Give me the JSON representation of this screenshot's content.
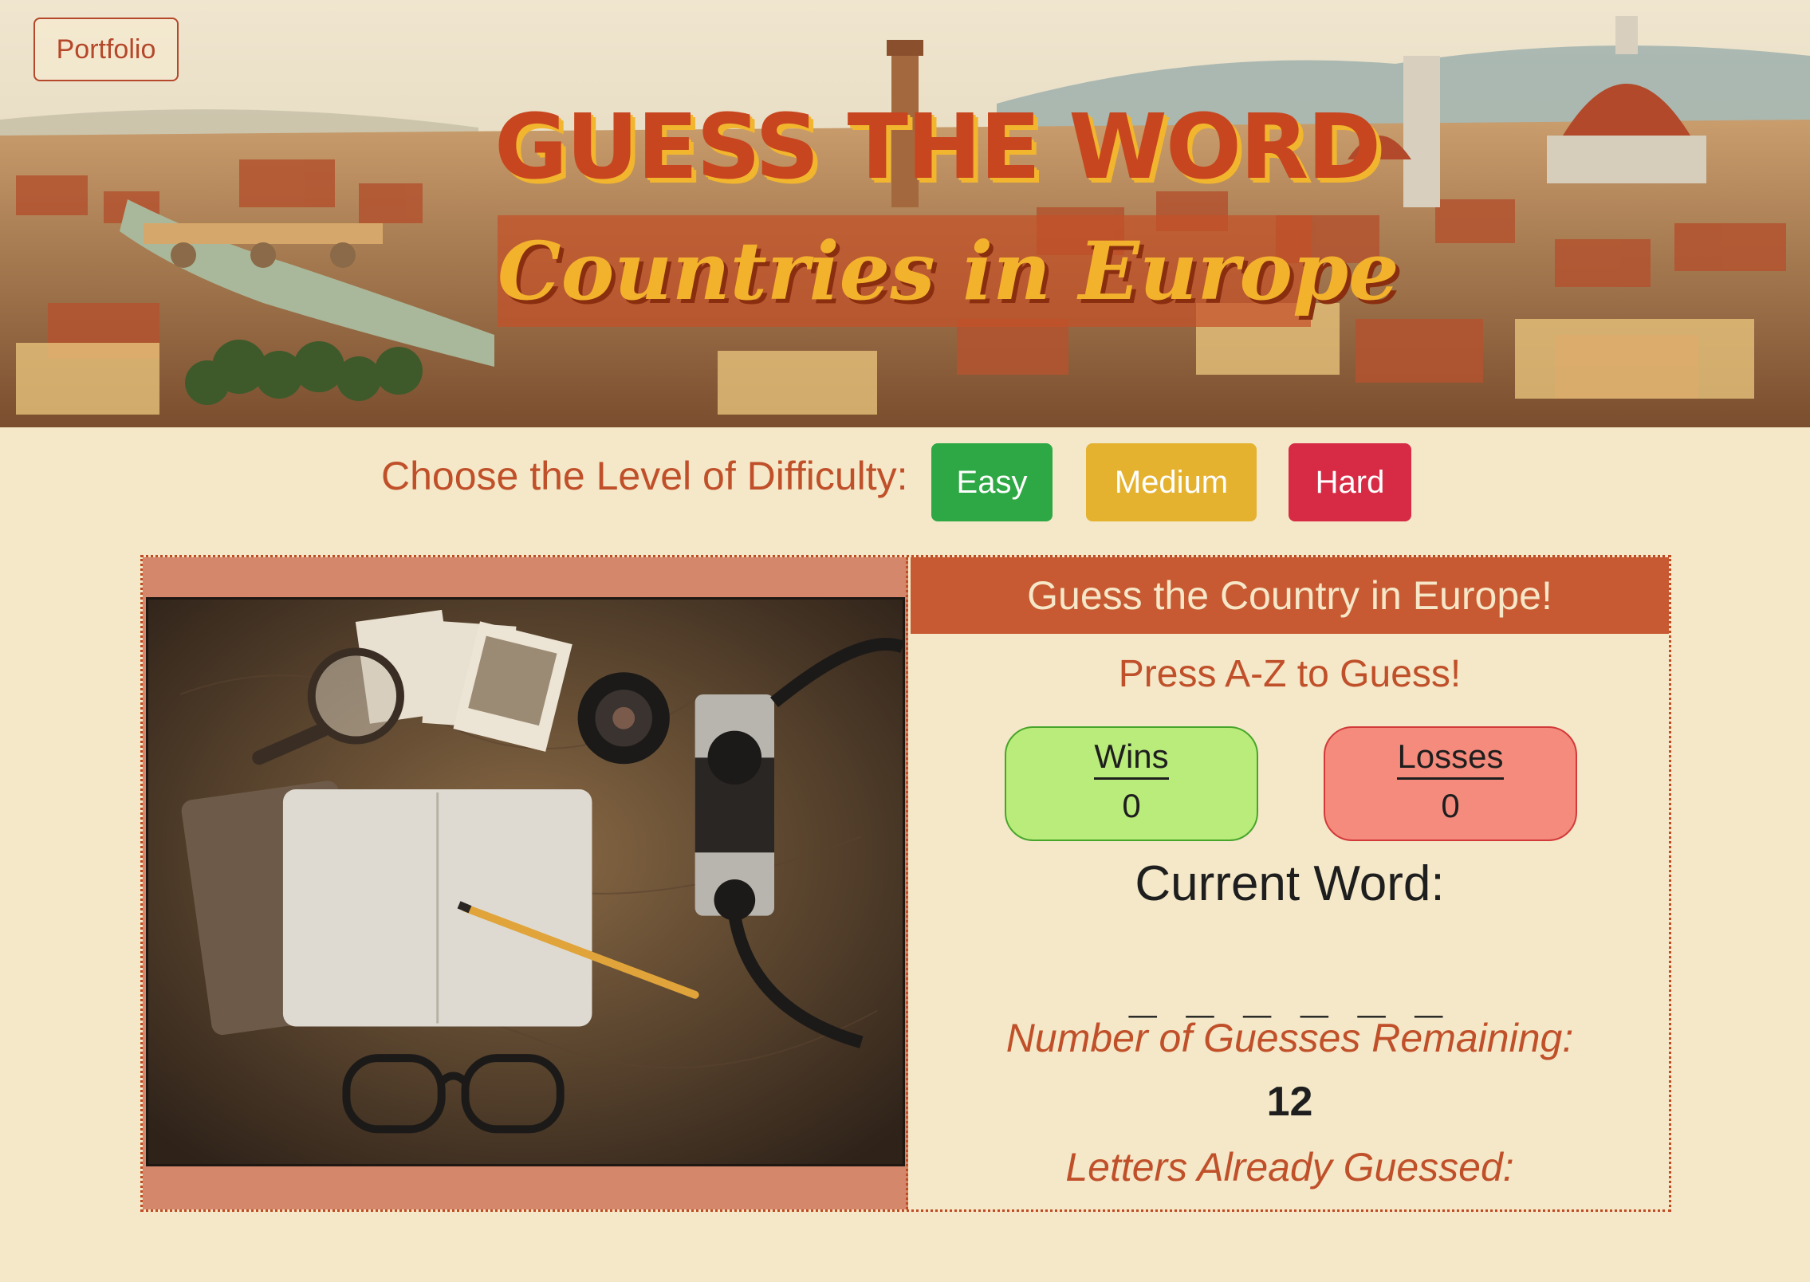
{
  "nav": {
    "portfolio_label": "Portfolio"
  },
  "hero": {
    "title": "GUESS THE WORD",
    "subtitle": "Countries in Europe"
  },
  "difficulty": {
    "label": "Choose the Level of Difficulty:",
    "options": [
      {
        "label": "Easy",
        "color": "#2ea844"
      },
      {
        "label": "Medium",
        "color": "#e5b230"
      },
      {
        "label": "Hard",
        "color": "#d72b45"
      }
    ]
  },
  "game": {
    "header": "Guess the Country in Europe!",
    "instruction": "Press A-Z to Guess!",
    "wins": {
      "label": "Wins",
      "value": "0"
    },
    "losses": {
      "label": "Losses",
      "value": "0"
    },
    "current_word_label": "Current Word:",
    "current_word": "_ _ _ _ _ _",
    "guesses_remaining_label": "Number of Guesses Remaining:",
    "guesses_remaining": "12",
    "letters_guessed_label": "Letters Already Guessed:"
  },
  "colors": {
    "background": "#f4e8c8",
    "accent": "#c0502a",
    "panel_header": "#c75a32"
  }
}
